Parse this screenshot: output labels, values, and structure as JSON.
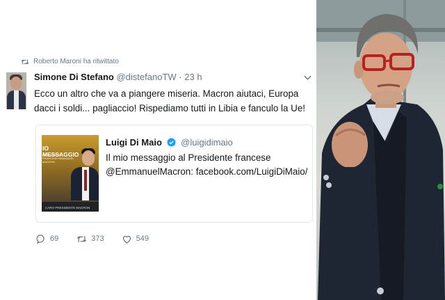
{
  "retweet": {
    "label": "Roberto Maroni ha ritwittato",
    "icon": "retweet-icon"
  },
  "tweet": {
    "author_name": "Simone Di Stefano",
    "author_handle": "@distefanoTW",
    "separator": "·",
    "time": "23 h",
    "text": "Ecco un altro che va a piangere miseria. Macron aiutaci, Europa dacci i soldi... pagliaccio! Rispediamo tutti in Libia e fanculo la Ue!",
    "menu_icon": "chevron-down-icon"
  },
  "quote": {
    "author_name": "Luigi Di Maio",
    "author_handle": "@luigidimaio",
    "verified_icon": "verified-badge-icon",
    "line1": "Il mio messaggio al Presidente francese",
    "line2": "@EmmanuelMacron: facebook.com/LuigiDiMaio/vi...",
    "thumb_title": "IO MESSAGGIO",
    "thumb_sub": "PRESIDENTE FRANCESE EMMANUEL MACRON",
    "thumb_caption": "CARO PRESIDENTE MACRON"
  },
  "actions": {
    "reply_count": "69",
    "retweet_count": "373",
    "like_count": "549",
    "reply_icon": "reply-icon",
    "retweet_icon": "retweet-icon",
    "like_icon": "heart-icon"
  },
  "colors": {
    "text": "#14171a",
    "secondary": "#657786",
    "verified": "#1da1f2",
    "border": "#e1e8ed"
  }
}
